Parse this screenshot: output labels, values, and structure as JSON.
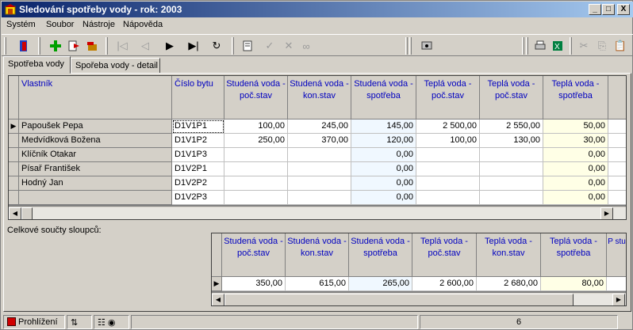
{
  "window": {
    "title": "Sledování spotřeby vody - rok: 2003",
    "buttons": [
      "_",
      "□",
      "X"
    ]
  },
  "menu": [
    "Systém",
    "Soubor",
    "Nástroje",
    "Nápověda"
  ],
  "tabs": [
    "Spotřeba vody",
    "Spořeba vody - detail"
  ],
  "grid": {
    "columns": [
      "Vlastník",
      "Číslo bytu",
      "Studená voda - poč.stav",
      "Studená voda - kon.stav",
      "Studená voda - spotřeba",
      "Teplá voda - poč.stav",
      "Teplá voda - poč.stav",
      "Teplá voda - spotřeba"
    ],
    "rows": [
      [
        "Papoušek Pepa",
        "D1V1P1",
        "100,00",
        "245,00",
        "145,00",
        "2 500,00",
        "2 550,00",
        "50,00"
      ],
      [
        "Medvídková Božena",
        "D1V1P2",
        "250,00",
        "370,00",
        "120,00",
        "100,00",
        "130,00",
        "30,00"
      ],
      [
        "Klíčník Otakar",
        "D1V1P3",
        "",
        "",
        "0,00",
        "",
        "",
        "0,00"
      ],
      [
        "Písař František",
        "D1V2P1",
        "",
        "",
        "0,00",
        "",
        "",
        "0,00"
      ],
      [
        "Hodný Jan",
        "D1V2P2",
        "",
        "",
        "0,00",
        "",
        "",
        "0,00"
      ],
      [
        "",
        "D1V2P3",
        "",
        "",
        "0,00",
        "",
        "",
        "0,00"
      ]
    ],
    "current_row_marker": "▶"
  },
  "totals": {
    "label": "Celkové součty sloupců:",
    "columns": [
      "Studená voda - poč.stav",
      "Studená voda - kon.stav",
      "Studená voda - spotřeba",
      "Teplá voda - poč.stav",
      "Teplá voda - kon.stav",
      "Teplá voda - spotřeba",
      "P stu"
    ],
    "values": [
      "350,00",
      "615,00",
      "265,00",
      "2 600,00",
      "2 680,00",
      "80,00",
      ""
    ]
  },
  "status": {
    "mode": "Prohlížení",
    "count": "6"
  },
  "icons": [
    "app-icon",
    "exit-icon",
    "add-icon",
    "import-icon",
    "export-icon",
    "first-icon",
    "prev-icon",
    "next-icon",
    "last-icon",
    "refresh-icon",
    "edit-icon",
    "confirm-icon",
    "cancel-icon",
    "glasses-icon",
    "view-icon",
    "print-icon",
    "excel-icon",
    "cut-icon",
    "copy-icon",
    "paste-icon"
  ]
}
